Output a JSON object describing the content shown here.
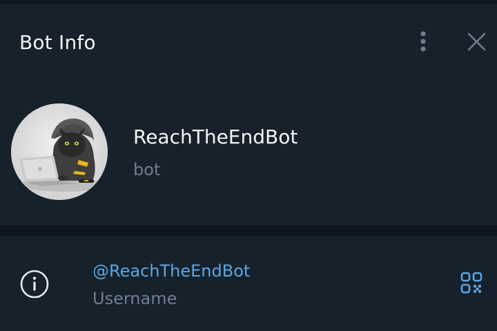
{
  "header": {
    "title": "Bot Info"
  },
  "profile": {
    "name": "ReachTheEndBot",
    "subtitle": "bot",
    "avatar_icon": "hooded-cat-with-laptop-avatar"
  },
  "info": {
    "username_value": "@ReachTheEndBot",
    "username_label": "Username",
    "info_icon": "info-icon",
    "qr_icon": "qr-code-icon"
  },
  "colors": {
    "background": "#17212b",
    "divider": "#0e1621",
    "text_primary": "#f5f5f5",
    "text_secondary": "#6d7f8f",
    "link": "#5aa7e6"
  }
}
